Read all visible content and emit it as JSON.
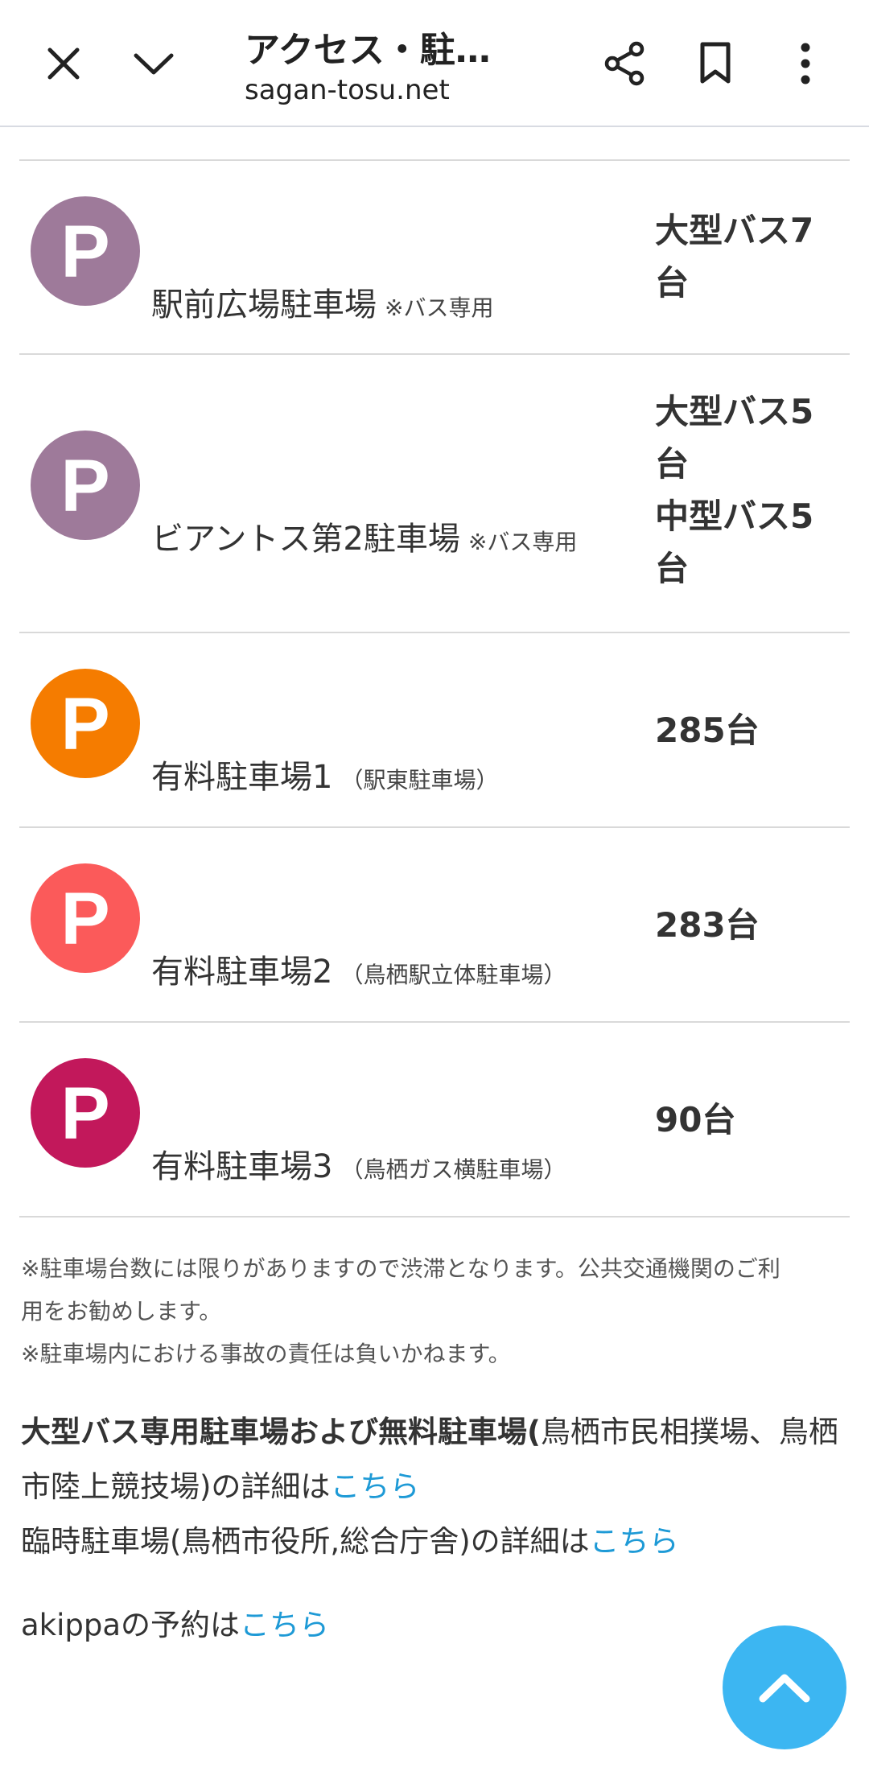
{
  "browser": {
    "title": "アクセス・駐…",
    "url": "sagan-tosu.net",
    "icons": [
      "close-icon",
      "chevron-down-icon",
      "share-icon",
      "bookmark-icon",
      "more-vert-icon"
    ]
  },
  "parking": {
    "rows": [
      {
        "name": "駅前広場駐車場",
        "note": "※バス専用",
        "capacity_lines": [
          "大型バス7",
          "台"
        ],
        "color": "#9e7a9a"
      },
      {
        "name": "ビアントス第2駐車場",
        "note": "※バス専用",
        "capacity_lines": [
          "大型バス5",
          "台",
          "中型バス5",
          "台"
        ],
        "color": "#9e7a9a"
      },
      {
        "name": "有料駐車場1",
        "note": "（駅東駐車場）",
        "capacity_lines": [
          "285台"
        ],
        "color": "#f57c00"
      },
      {
        "name": "有料駐車場2",
        "note": "（鳥栖駅立体駐車場）",
        "capacity_lines": [
          "283台"
        ],
        "color": "#fb5a5a"
      },
      {
        "name": "有料駐車場3",
        "note": "（鳥栖ガス横駐車場）",
        "capacity_lines": [
          "90台"
        ],
        "color": "#c2185b"
      }
    ],
    "icon_letter": "P"
  },
  "notes": {
    "line1": "※駐車場台数には限りがありますので渋滞となります。公共交通機関のご利",
    "line2": "用をお勧めします。",
    "line3": "※駐車場内における事故の責任は負いかねます。"
  },
  "links": {
    "bus_free_bold": "大型バス専用駐車場および無料駐車場(",
    "bus_free_rest1": "鳥栖市民相撲場、鳥栖",
    "bus_free_rest2": "市陸上競技場)の詳細は",
    "temp_text": "臨時駐車場(鳥栖市役所,総合庁舎)の詳細は",
    "akippa_text": "akippaの予約は",
    "here": "こちら"
  },
  "colors": {
    "link": "#1e9ad6",
    "fab": "#3cb6f2"
  }
}
